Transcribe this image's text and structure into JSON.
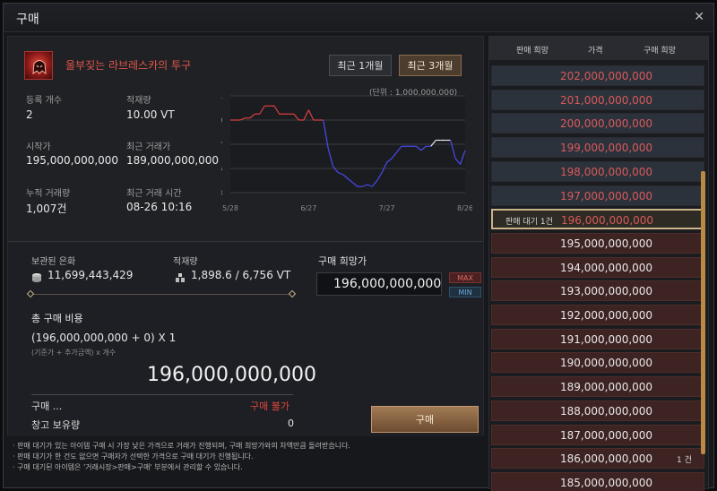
{
  "window": {
    "title": "구매",
    "close_icon": "close-icon"
  },
  "item": {
    "name": "울부짖는 라브레스카의 투구",
    "icon": "helmet-icon",
    "name_color": "#e0554a"
  },
  "period": {
    "one_month": "최근 1개월",
    "three_month": "최근 3개월",
    "selected": "three_month"
  },
  "stats": {
    "reg_count_label": "등록 개수",
    "reg_count": "2",
    "weight_label": "적재량",
    "weight": "10.00 VT",
    "start_price_label": "시작가",
    "start_price": "195,000,000,000",
    "recent_price_label": "최근 거래가",
    "recent_price": "189,000,000,000",
    "cum_trades_label": "누적 거래량",
    "cum_trades": "1,007건",
    "recent_time_label": "최근 거래 시간",
    "recent_time": "08-26 10:16"
  },
  "chart_data": {
    "type": "line",
    "unit_note": "(단위 : 1,000,000,000)",
    "xtick_labels": [
      "5/28",
      "6/27",
      "7/27",
      "8/26"
    ],
    "yticks": [
      173,
      185,
      197,
      209,
      221
    ],
    "ylim": [
      173,
      221
    ],
    "y": [
      209,
      209,
      209,
      210,
      210,
      212,
      212,
      216,
      216,
      216,
      212,
      212,
      212,
      212,
      209,
      209,
      214,
      209,
      209,
      209,
      195,
      186,
      183,
      182,
      180,
      178,
      176,
      176,
      177,
      176,
      179,
      183,
      188,
      190,
      193,
      196,
      196,
      196,
      196,
      194,
      196,
      196,
      199,
      199,
      199,
      199,
      190,
      187,
      194
    ]
  },
  "funds": {
    "held_label": "보관된 은화",
    "held_value": "11,699,443,429",
    "held_icon": "silver-coins-icon",
    "weight_label": "적재량",
    "weight_value": "1,898.6 / 6,756 VT",
    "weight_icon": "weight-icon",
    "wish_price_label": "구매 희망가",
    "wish_price": "196,000,000,000",
    "max_label": "MAX",
    "min_label": "MIN"
  },
  "cost": {
    "label": "총 구매 비용",
    "formula": "(196,000,000,000 + 0) X 1",
    "formula_hint": "(기준가 + 추가금액) x 개수",
    "total": "196,000,000,000"
  },
  "status": {
    "buy_label": "구매 ...",
    "buy_status": "구매 불가",
    "storage_label": "창고 보유량",
    "storage_value": "0",
    "buy_button": "구매"
  },
  "notes": [
    "· 판매 대기가 있는 아이템 구매 시 가장 낮은 가격으로 거래가 진행되며, 구매 희망가와의 차액만큼 돌려받습니다.",
    "· 판매 대기가 한 건도 없으면 구매자가 선택한 가격으로 구매 대기가 진행됩니다.",
    "· 구매 대기된 아이템은 '거래시장>판매>구매' 부분에서 관리할 수 있습니다."
  ],
  "order_book": {
    "headers": [
      "판매 희망",
      "가격",
      "구매 희망"
    ],
    "rows": [
      {
        "price": "202,000,000,000",
        "kind": "sell"
      },
      {
        "price": "201,000,000,000",
        "kind": "sell"
      },
      {
        "price": "200,000,000,000",
        "kind": "sell"
      },
      {
        "price": "199,000,000,000",
        "kind": "sell"
      },
      {
        "price": "198,000,000,000",
        "kind": "sell"
      },
      {
        "price": "197,000,000,000",
        "kind": "sell"
      },
      {
        "price": "196,000,000,000",
        "kind": "selected",
        "pending": "판매 대기 1건"
      },
      {
        "price": "195,000,000,000",
        "kind": "buy"
      },
      {
        "price": "194,000,000,000",
        "kind": "buy"
      },
      {
        "price": "193,000,000,000",
        "kind": "buy"
      },
      {
        "price": "192,000,000,000",
        "kind": "buy"
      },
      {
        "price": "191,000,000,000",
        "kind": "buy"
      },
      {
        "price": "190,000,000,000",
        "kind": "buy"
      },
      {
        "price": "189,000,000,000",
        "kind": "buy"
      },
      {
        "price": "188,000,000,000",
        "kind": "buy"
      },
      {
        "price": "187,000,000,000",
        "kind": "buy"
      },
      {
        "price": "186,000,000,000",
        "kind": "buy",
        "count": "1 건"
      },
      {
        "price": "185,000,000,000",
        "kind": "buy"
      }
    ]
  }
}
